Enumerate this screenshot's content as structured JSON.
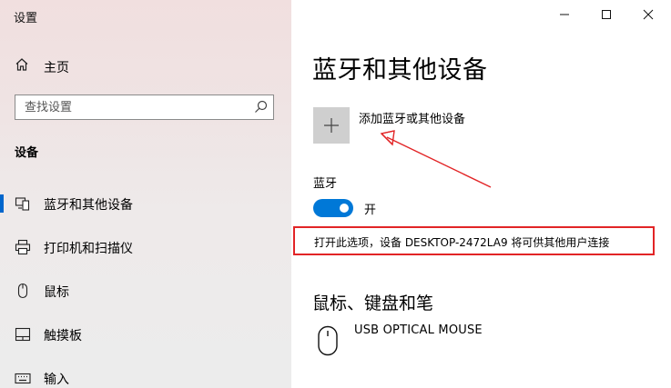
{
  "window": {
    "title": "设置"
  },
  "sidebar": {
    "home_label": "主页",
    "search_placeholder": "查找设置",
    "section_title": "设备",
    "items": [
      {
        "label": "蓝牙和其他设备",
        "icon": "bluetooth-devices-icon",
        "active": true
      },
      {
        "label": "打印机和扫描仪",
        "icon": "printer-icon",
        "active": false
      },
      {
        "label": "鼠标",
        "icon": "mouse-icon",
        "active": false
      },
      {
        "label": "触摸板",
        "icon": "touchpad-icon",
        "active": false
      },
      {
        "label": "输入",
        "icon": "keyboard-icon",
        "active": false
      }
    ]
  },
  "main": {
    "title": "蓝牙和其他设备",
    "add_device_label": "添加蓝牙或其他设备",
    "bluetooth": {
      "heading": "蓝牙",
      "toggle_state": "开",
      "on": true,
      "notice": "打开此选项，设备 DESKTOP-2472LA9 将可供其他用户连接"
    },
    "mouse_section": {
      "heading": "鼠标、键盘和笔",
      "devices": [
        {
          "name": "USB OPTICAL MOUSE",
          "icon": "mouse-icon"
        }
      ]
    }
  },
  "colors": {
    "accent": "#0078d7",
    "annotation_red": "#e22426",
    "add_button_bg": "#cfcfcf"
  }
}
